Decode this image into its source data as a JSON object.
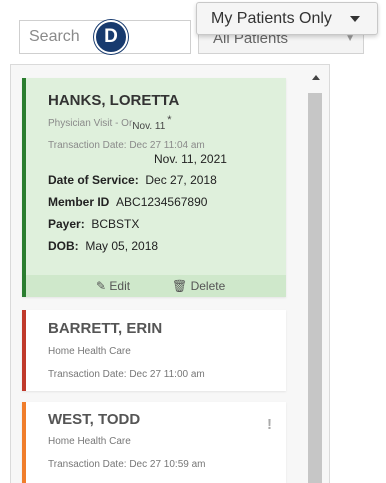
{
  "search": {
    "placeholder": "Search"
  },
  "marker": {
    "label": "D",
    "color": "#173a6e"
  },
  "filter": {
    "all_patients_label": "All Patients",
    "my_patients_label": "My Patients Only"
  },
  "cards": [
    {
      "name": "HANKS, LORETTA",
      "type": "Physician Visit - Or",
      "type_overlap": "Nov. 11",
      "mark": "*",
      "transaction": "Transaction Date: Dec 27 11:04 am",
      "overlap_date": "Nov. 11, 2021",
      "dos_label": "Date of Service:",
      "dos_value": "Dec 27, 2018",
      "member_label": "Member ID",
      "member_value": "ABC1234567890",
      "payer_label": "Payer:",
      "payer_value": "BCBSTX",
      "dob_label": "DOB:",
      "dob_value": "May 05, 2018",
      "edit_label": "Edit",
      "delete_label": "Delete",
      "status_color": "#2a7d2f"
    },
    {
      "name": "BARRETT, ERIN",
      "type": "Home Health Care",
      "transaction": "Transaction Date: Dec 27 11:00 am",
      "status_color": "#c0392b"
    },
    {
      "name": "WEST, TODD",
      "type": "Home Health Care",
      "transaction": "Transaction Date: Dec 27 10:59 am",
      "alert": "!",
      "status_color": "#f07d2b"
    }
  ]
}
